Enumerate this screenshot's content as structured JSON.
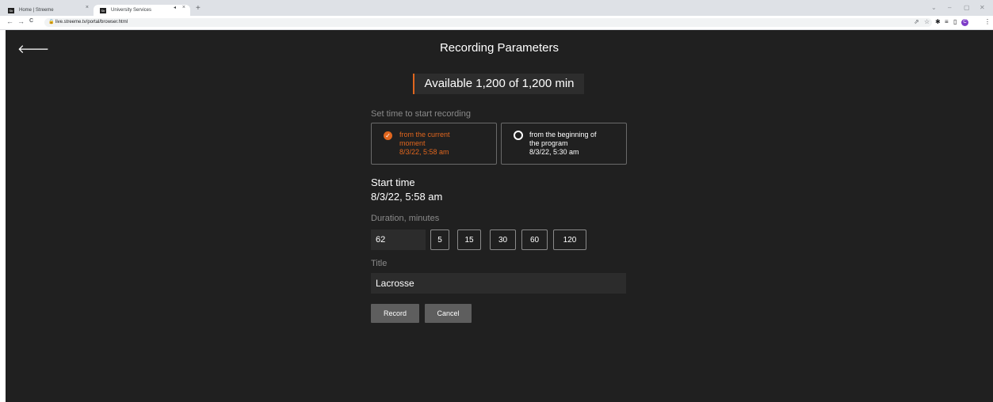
{
  "browser": {
    "tabs": [
      {
        "favicon": "Str",
        "label": "Home | Streeme"
      },
      {
        "favicon": "Str",
        "label": "University Services"
      }
    ],
    "url": "live.streeme.tv/portal/browser.html",
    "profile_initial": "C"
  },
  "icons": {
    "back": "←",
    "forward": "→",
    "reload": "C",
    "lock": "🔒",
    "share": "⇗",
    "star": "☆",
    "extensions": "✱",
    "reading_list": "≡",
    "side_panel": "▯",
    "menu": "⋮",
    "close_tab": "×",
    "mute": "◂",
    "new_tab": "+",
    "win_down": "⌄",
    "win_min": "–",
    "win_restore": "▢",
    "win_close": "✕",
    "app_back": "🡐",
    "check": "✓"
  },
  "page": {
    "title": "Recording Parameters",
    "available": "Available 1,200 of 1,200 min",
    "set_time_label": "Set time to start recording",
    "options": [
      {
        "line1": "from the current",
        "line2": "moment",
        "time": "8/3/22, 5:58 am",
        "selected": true
      },
      {
        "line1": "from the beginning of",
        "line2": "the program",
        "time": "8/3/22, 5:30 am",
        "selected": false
      }
    ],
    "start_time_label": "Start time",
    "start_time_value": "8/3/22, 5:58 am",
    "duration_label": "Duration, minutes",
    "duration_value": "62",
    "duration_presets": [
      "5",
      "15",
      "30",
      "60",
      "120"
    ],
    "title_label": "Title",
    "title_value": "Lacrosse",
    "record_label": "Record",
    "cancel_label": "Cancel"
  },
  "colors": {
    "accent": "#e0661e",
    "background": "#202020",
    "button": "#5e5e5e"
  }
}
